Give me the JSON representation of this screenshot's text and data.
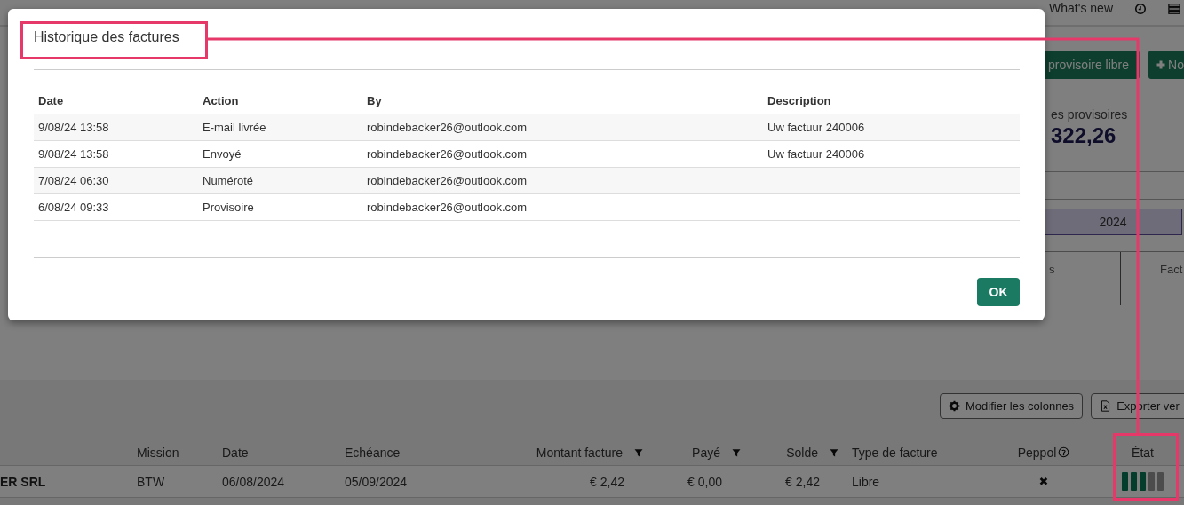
{
  "nav": {
    "whats_new": "What's new"
  },
  "toolbar": {
    "buttons": [
      {
        "label": "provisoire libre",
        "kind": "plain"
      },
      {
        "label": "No",
        "kind": "add"
      }
    ]
  },
  "summary": {
    "label": "es provisoires",
    "value": "322,26"
  },
  "period": {
    "year": "2024",
    "column_1": "s",
    "column_2": "Fact"
  },
  "modal": {
    "title": "Historique des factures",
    "columns": [
      "Date",
      "Action",
      "By",
      "Description"
    ],
    "rows": [
      [
        "9/08/24 13:58",
        "E-mail livrée",
        "robindebacker26@outlook.com",
        "Uw factuur 240006"
      ],
      [
        "9/08/24 13:58",
        "Envoyé",
        "robindebacker26@outlook.com",
        "Uw factuur 240006"
      ],
      [
        "7/08/24 06:30",
        "Numéroté",
        "robindebacker26@outlook.com",
        ""
      ],
      [
        "6/08/24 09:33",
        "Provisoire",
        "robindebacker26@outlook.com",
        ""
      ]
    ],
    "ok": "OK"
  },
  "invoices": {
    "actions": [
      {
        "label": "Modifier les colonnes",
        "kind": "columns"
      },
      {
        "label": "Exporter ver",
        "kind": "export"
      }
    ],
    "columns": [
      {
        "label": "Mission",
        "filter": false,
        "help": false
      },
      {
        "label": "Date",
        "filter": false,
        "help": false
      },
      {
        "label": "Echéance",
        "filter": false,
        "help": false
      },
      {
        "label": "Montant facture",
        "filter": true,
        "help": false
      },
      {
        "label": "Payé",
        "filter": true,
        "help": false
      },
      {
        "label": "Solde",
        "filter": true,
        "help": false
      },
      {
        "label": "Type de facture",
        "filter": false,
        "help": false
      },
      {
        "label": "Peppol",
        "filter": false,
        "help": true
      },
      {
        "label": "État",
        "filter": false,
        "help": false
      }
    ],
    "rows": [
      {
        "client": "ER SRL",
        "cells": [
          "BTW",
          "06/08/2024",
          "05/09/2024",
          "€ 2,42",
          "€ 0,00",
          "€ 2,42",
          "Libre",
          "✖"
        ],
        "steps": [
          {
            "done": true
          },
          {
            "done": true
          },
          {
            "done": true
          },
          {
            "done": false
          },
          {
            "done": false
          }
        ]
      }
    ]
  }
}
